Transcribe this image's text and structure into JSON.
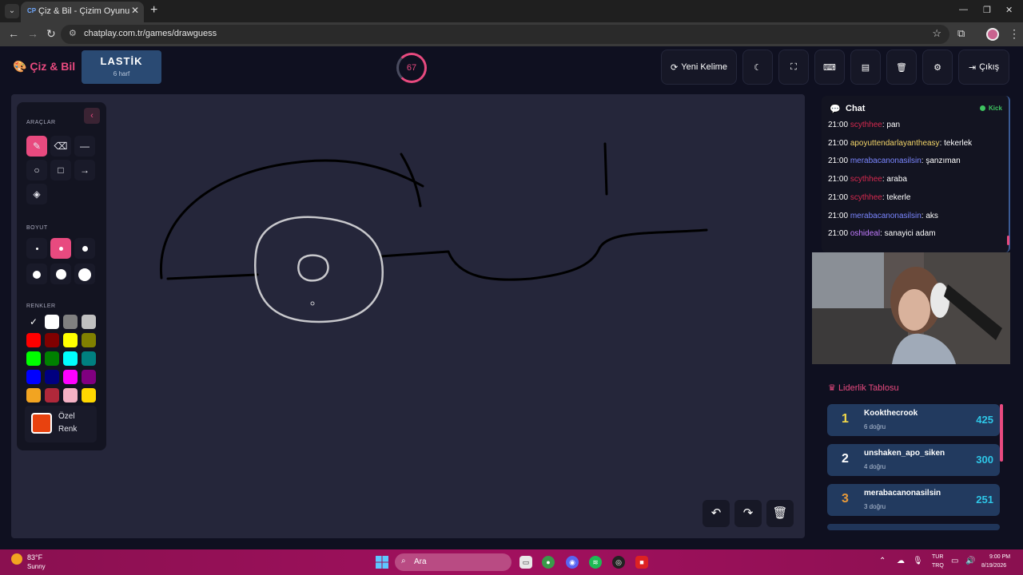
{
  "browser": {
    "tab_favicon": "CP",
    "tab_title": "Çiz & Bil - Çizim Oyunu",
    "url": "chatplay.com.tr/games/drawguess"
  },
  "header": {
    "logo": "Çiz & Bil",
    "word": "LASTİK",
    "word_length": "6 harf",
    "timer": "67",
    "new_word_label": "Yeni Kelime",
    "exit_label": "Çıkış"
  },
  "tools": {
    "tools_title": "ARAÇLAR",
    "size_title": "BOYUT",
    "colors_title": "RENKLER",
    "custom_label_1": "Özel",
    "custom_label_2": "Renk",
    "custom_color": "#e8420f",
    "palette": [
      "#ffffff",
      "#ffffff",
      "#808080",
      "#c0c0c0",
      "#ff0000",
      "#800000",
      "#ffff00",
      "#808000",
      "#00ff00",
      "#008000",
      "#00ffff",
      "#008080",
      "#0000ff",
      "#000080",
      "#ff00ff",
      "#800080",
      "#f2a421",
      "#b0283a",
      "#f4b1c4",
      "#ffd700"
    ]
  },
  "chat": {
    "title": "Chat",
    "status": "Kick",
    "messages": [
      {
        "time": "21:00",
        "user": "scythhee",
        "text": ": pan"
      },
      {
        "time": "21:00",
        "user": "apoyuttendarlayantheasy",
        "text": ": tekerlek"
      },
      {
        "time": "21:00",
        "user": "merabacanonasilsin",
        "text": ": şanzıman"
      },
      {
        "time": "21:00",
        "user": "scythhee",
        "text": ": araba"
      },
      {
        "time": "21:00",
        "user": "scythhee",
        "text": ": tekerle"
      },
      {
        "time": "21:00",
        "user": "merabacanonasilsin",
        "text": ": aks"
      },
      {
        "time": "21:00",
        "user": "oshideal",
        "text": ": sanayici adam"
      }
    ]
  },
  "leaderboard": {
    "title": "Liderlik Tablosu",
    "rows": [
      {
        "rank": "1",
        "name": "Kookthecrook",
        "sub": "6 doğru",
        "score": "425"
      },
      {
        "rank": "2",
        "name": "unshaken_apo_siken",
        "sub": "4 doğru",
        "score": "300"
      },
      {
        "rank": "3",
        "name": "merabacanonasilsin",
        "sub": "3 doğru",
        "score": "251"
      }
    ]
  },
  "taskbar": {
    "temp": "83°F",
    "condition": "Sunny",
    "search_placeholder": "Ara",
    "lang_1": "TUR",
    "lang_2": "TRQ",
    "time": "9:00 PM",
    "date": "8/19/2026"
  },
  "colors": {
    "accent": "#e84a7f",
    "score": "#2ec7e8",
    "rank_1": "#f2d84a",
    "rank_3": "#e89a3a"
  },
  "icons": {
    "tools": [
      "brush-icon",
      "eraser-icon",
      "line-icon",
      "circle-icon",
      "rectangle-icon",
      "arrow-icon",
      "fill-bucket-icon"
    ],
    "header": [
      "refresh-icon",
      "moon-icon",
      "fullscreen-icon",
      "keyboard-icon",
      "archive-icon",
      "trash-icon",
      "gear-icon",
      "logout-icon"
    ],
    "canvas": [
      "undo-icon",
      "redo-icon",
      "trash-icon"
    ]
  }
}
